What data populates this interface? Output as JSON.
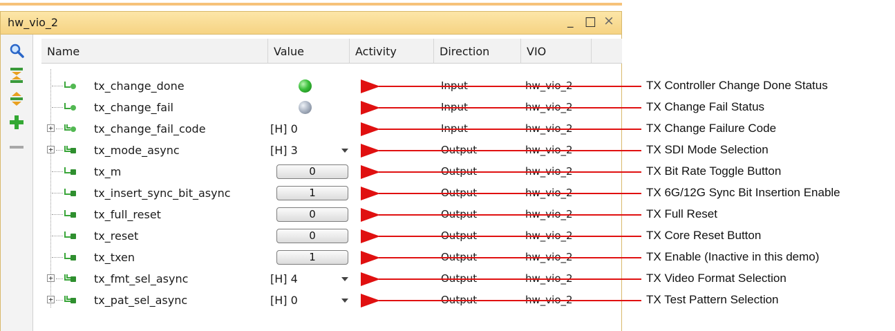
{
  "window": {
    "title": "hw_vio_2",
    "minimize_glyph": "_",
    "maximize_glyph": "☐",
    "close_glyph": "×"
  },
  "toolbar": {
    "buttons": [
      {
        "name": "search-icon"
      },
      {
        "name": "collapse-all-icon"
      },
      {
        "name": "expand-all-icon"
      },
      {
        "name": "add-icon"
      },
      {
        "name": "remove-icon"
      }
    ]
  },
  "columns": [
    "Name",
    "Value",
    "Activity",
    "Direction",
    "VIO"
  ],
  "rows": [
    {
      "name": "tx_change_done",
      "value_type": "led",
      "led": "on",
      "value": "",
      "direction": "Input",
      "vio": "hw_vio_2",
      "expandable": false,
      "icon": "input-probe-icon",
      "annotation": "TX Controller Change Done Status"
    },
    {
      "name": "tx_change_fail",
      "value_type": "led",
      "led": "off",
      "value": "",
      "direction": "Input",
      "vio": "hw_vio_2",
      "expandable": false,
      "icon": "input-probe-icon",
      "annotation": "TX Change Fail Status"
    },
    {
      "name": "tx_change_fail_code",
      "value_type": "text",
      "value": "[H] 0",
      "direction": "Input",
      "vio": "hw_vio_2",
      "expandable": true,
      "icon": "input-bus-icon",
      "annotation": "TX Change Failure Code"
    },
    {
      "name": "tx_mode_async",
      "value_type": "dropdown",
      "value": "[H] 3",
      "direction": "Output",
      "vio": "hw_vio_2",
      "expandable": true,
      "icon": "output-bus-icon",
      "annotation": "TX SDI Mode Selection"
    },
    {
      "name": "tx_m",
      "value_type": "button",
      "value": "0",
      "direction": "Output",
      "vio": "hw_vio_2",
      "expandable": false,
      "icon": "output-probe-icon",
      "annotation": "TX Bit Rate Toggle Button"
    },
    {
      "name": "tx_insert_sync_bit_async",
      "value_type": "button",
      "value": "1",
      "direction": "Output",
      "vio": "hw_vio_2",
      "expandable": false,
      "icon": "output-probe-icon",
      "annotation": "TX 6G/12G Sync Bit Insertion Enable"
    },
    {
      "name": "tx_full_reset",
      "value_type": "button",
      "value": "0",
      "direction": "Output",
      "vio": "hw_vio_2",
      "expandable": false,
      "icon": "output-probe-icon",
      "annotation": "TX Full Reset"
    },
    {
      "name": "tx_reset",
      "value_type": "button",
      "value": "0",
      "direction": "Output",
      "vio": "hw_vio_2",
      "expandable": false,
      "icon": "output-probe-icon",
      "annotation": "TX Core Reset Button"
    },
    {
      "name": "tx_txen",
      "value_type": "button",
      "value": "1",
      "direction": "Output",
      "vio": "hw_vio_2",
      "expandable": false,
      "icon": "output-probe-icon",
      "annotation": "TX Enable (Inactive in this demo)"
    },
    {
      "name": "tx_fmt_sel_async",
      "value_type": "dropdown",
      "value": "[H] 4",
      "direction": "Output",
      "vio": "hw_vio_2",
      "expandable": true,
      "icon": "output-bus-icon",
      "annotation": "TX Video Format Selection"
    },
    {
      "name": "tx_pat_sel_async",
      "value_type": "dropdown",
      "value": "[H] 0",
      "direction": "Output",
      "vio": "hw_vio_2",
      "expandable": true,
      "icon": "output-bus-icon",
      "annotation": "TX Test Pattern Selection"
    }
  ],
  "colors": {
    "arrow": "#e01010",
    "title_bg": "#f6d383",
    "led_on": "#3bbf3b",
    "led_off": "#a7b1c0"
  }
}
